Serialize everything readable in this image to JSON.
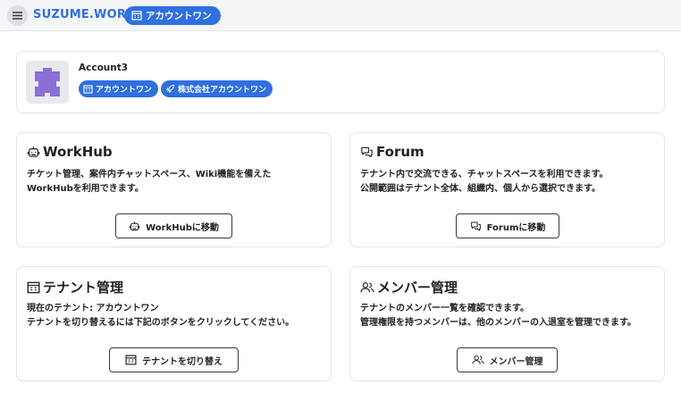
{
  "header": {
    "brand": "SUZUME.WORK",
    "tenant_chip": "アカウントワン",
    "accent_color": "#2f6fe0",
    "icons": {
      "menu": "hamburger-menu-icon",
      "tenant": "building-icon"
    }
  },
  "account": {
    "name": "Account3",
    "tenant_chip": "アカウントワン",
    "org_chip": "株式会社アカウントワン",
    "avatar_icon": "puzzle-avatar-icon",
    "avatar_color": "#8a6fd6"
  },
  "features": {
    "workhub": {
      "title": "WorkHub",
      "desc": [
        "チケット管理、案件内チャットスペース、Wiki機能を備えた",
        "WorkHubを利用できます。"
      ],
      "button": "WorkHubに移動",
      "icon": "robot-icon"
    },
    "forum": {
      "title": "Forum",
      "desc": [
        "テナント内で交流できる、チャットスペースを利用できます。",
        "公開範囲はテナント全体、組織内、個人から選択できます。"
      ],
      "button": "Forumに移動",
      "icon": "chat-bubbles-icon"
    },
    "tenant": {
      "title": "テナント管理",
      "desc": [
        "現在のテナント: アカウントワン",
        "テナントを切り替えるには下記のボタンをクリックしてください。"
      ],
      "button": "テナントを切り替え",
      "icon": "building-icon"
    },
    "member": {
      "title": "メンバー管理",
      "desc": [
        "テナントのメンバー一覧を確認できます。",
        "管理権限を持つメンバーは、他のメンバーの入退室を管理できます。"
      ],
      "button": "メンバー管理",
      "icon": "users-icon"
    }
  }
}
